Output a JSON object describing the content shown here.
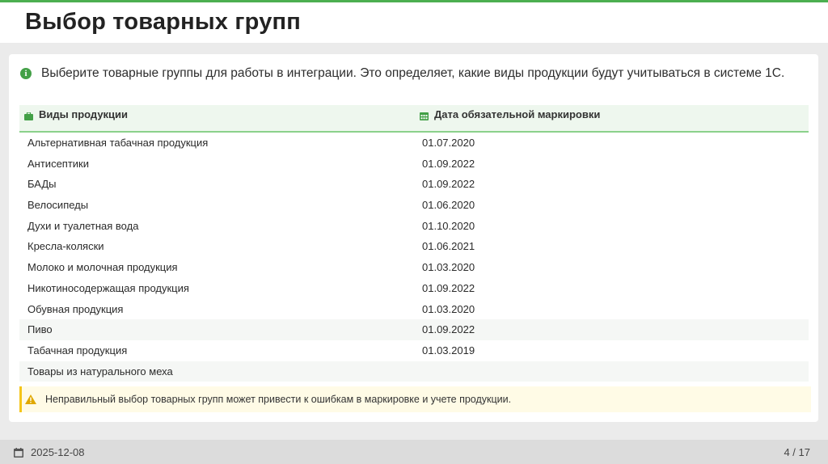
{
  "slide": {
    "title": "Выбор товарных групп",
    "info_icon": "info-circle-icon",
    "info_text": "Выберите товарные группы для работы в интеграции. Это определяет, какие виды продукции будут учитываться в системе 1С."
  },
  "table": {
    "columns": [
      {
        "label": "Виды продукции",
        "icon": "briefcase-icon"
      },
      {
        "label": "Дата обязательной маркировки",
        "icon": "calendar-icon"
      }
    ],
    "rows": [
      {
        "name": "Альтернативная табачная продукция",
        "date": "01.07.2020"
      },
      {
        "name": "Антисептики",
        "date": "01.09.2022"
      },
      {
        "name": "БАДы",
        "date": "01.09.2022"
      },
      {
        "name": "Велосипеды",
        "date": "01.06.2020"
      },
      {
        "name": "Духи и туалетная вода",
        "date": "01.10.2020"
      },
      {
        "name": "Кресла-коляски",
        "date": "01.06.2021"
      },
      {
        "name": "Молоко и молочная продукция",
        "date": "01.03.2020"
      },
      {
        "name": "Никотиносодержащая продукция",
        "date": "01.09.2022"
      },
      {
        "name": "Обувная продукция",
        "date": "01.03.2020"
      },
      {
        "name": "Пиво",
        "date": "01.09.2022"
      },
      {
        "name": "Табачная продукция",
        "date": "01.03.2019"
      },
      {
        "name": "Товары из натурального меха",
        "date": ""
      }
    ]
  },
  "warning": {
    "icon": "warning-triangle-icon",
    "text": "Неправильный выбор товарных групп может привести к ошибкам в маркировке и учете продукции."
  },
  "footer": {
    "date_icon": "calendar-icon",
    "date": "2025-12-08",
    "page": "4 / 17"
  },
  "colors": {
    "accent": "#4caf50",
    "header_bg": "#eef7ee",
    "warning_border": "#f5c518",
    "warning_bg": "#fffbe6"
  }
}
